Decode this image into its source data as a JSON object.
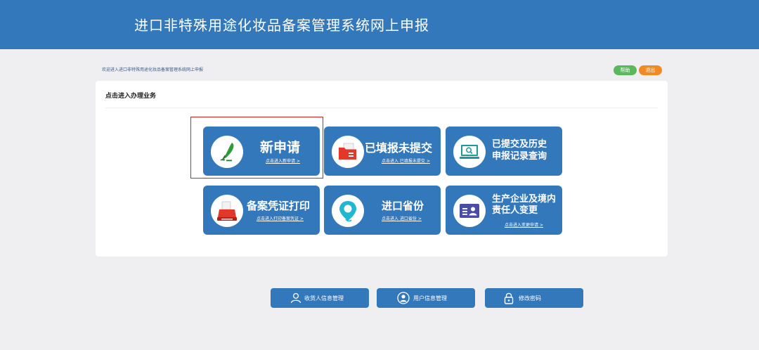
{
  "header": {
    "title": "进口非特殊用途化妆品备案管理系统网上申报"
  },
  "welcome_text": "欢迎进入进口非特殊用途化妆品备案管理系统网上申报",
  "top_buttons": {
    "help": "帮助",
    "exit": "退出"
  },
  "panel": {
    "title": "点击进入办理业务"
  },
  "tiles": [
    {
      "title": "新申请",
      "link": "点击进入新申请 >"
    },
    {
      "title": "已填报未提交",
      "link": "点击进入 已填报未提交 >"
    },
    {
      "title_line1": "已提交及历史",
      "title_line2": "申报记录查询"
    },
    {
      "title": "备案凭证打印",
      "link": "点击进入打印备案凭证 >"
    },
    {
      "title": "进口省份",
      "link": "点击进入 进口省份 >"
    },
    {
      "title_line1": "生产企业及境内",
      "title_line2": "责任人变更",
      "link": "点击进入变更申请 >"
    }
  ],
  "bottom_buttons": {
    "receiver": "收货人信息管理",
    "user": "用户信息管理",
    "password": "修改密码"
  },
  "colors": {
    "header": "#3478bc",
    "tile": "#3478bc",
    "help": "#5cb85c",
    "exit": "#f08a24",
    "highlight": "#e02020"
  }
}
